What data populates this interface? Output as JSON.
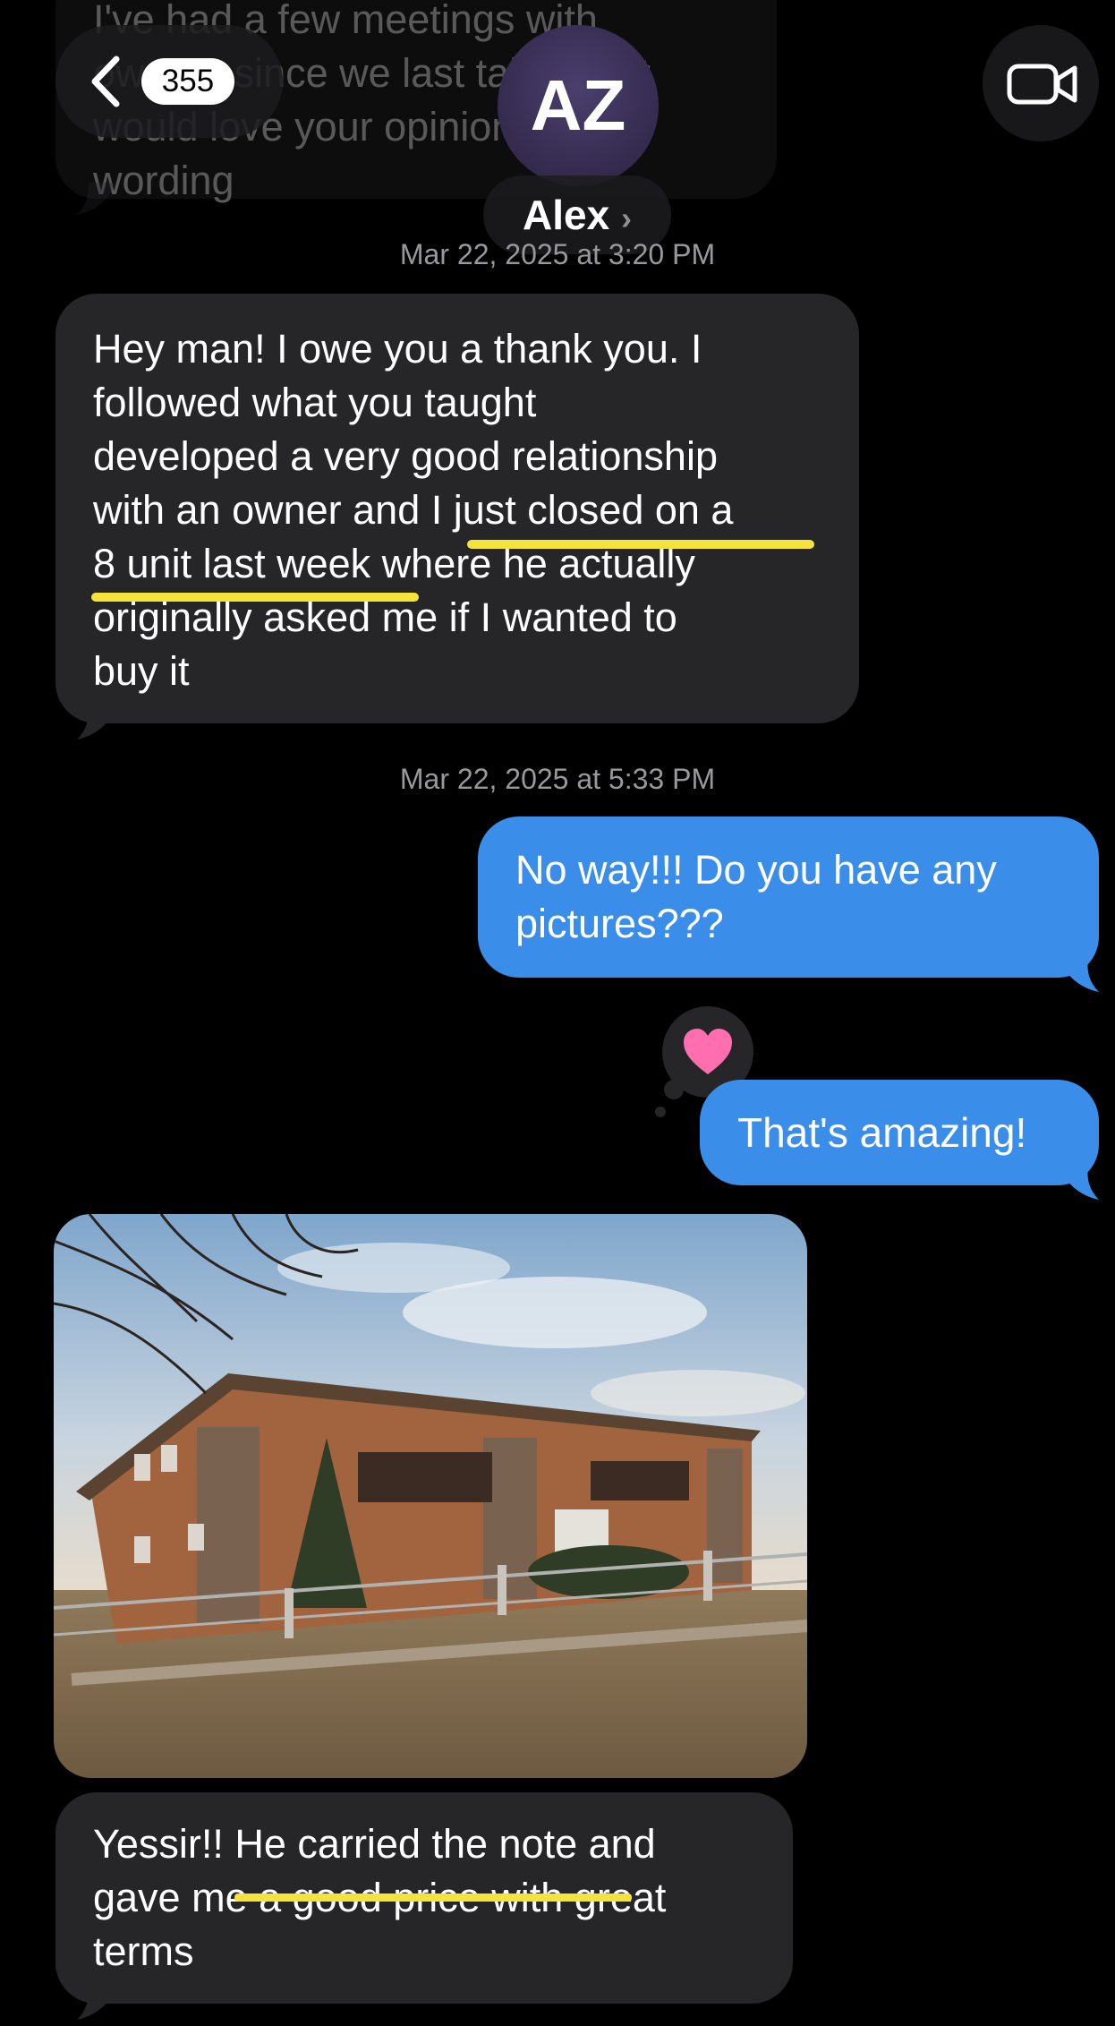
{
  "header": {
    "back_count": "355",
    "avatar_initials": "AZ",
    "contact_name": "Alex"
  },
  "prev_message": {
    "lines": [
      "I've had a few meetings with",
      "owners since we last talked but",
      "would love your opinion on my",
      "wording"
    ]
  },
  "timestamps": {
    "first": "Mar 22, 2025 at 3:20 PM",
    "second": "Mar 22, 2025 at 5:33 PM"
  },
  "messages": {
    "msg1": {
      "lines": [
        "Hey man! I owe you a thank you. I",
        "followed what you taught",
        "developed a very good relationship",
        "with an owner and I just closed on a",
        "8 unit last week where he actually",
        "originally asked me if I wanted to",
        "buy it"
      ]
    },
    "msg2": {
      "lines": [
        "No way!!! Do you have any",
        "pictures???"
      ]
    },
    "msg3": {
      "text": "That's amazing!",
      "reaction": "heart"
    },
    "msg4": {
      "lines": [
        "Yessir!! He carried the note and",
        "gave me a good price with great",
        "terms"
      ]
    }
  },
  "colors": {
    "incoming_bubble": "#262628",
    "outgoing_bubble": "#3a8ee9",
    "highlight": "#f5e33b",
    "reaction_heart": "#ff6fb0"
  }
}
